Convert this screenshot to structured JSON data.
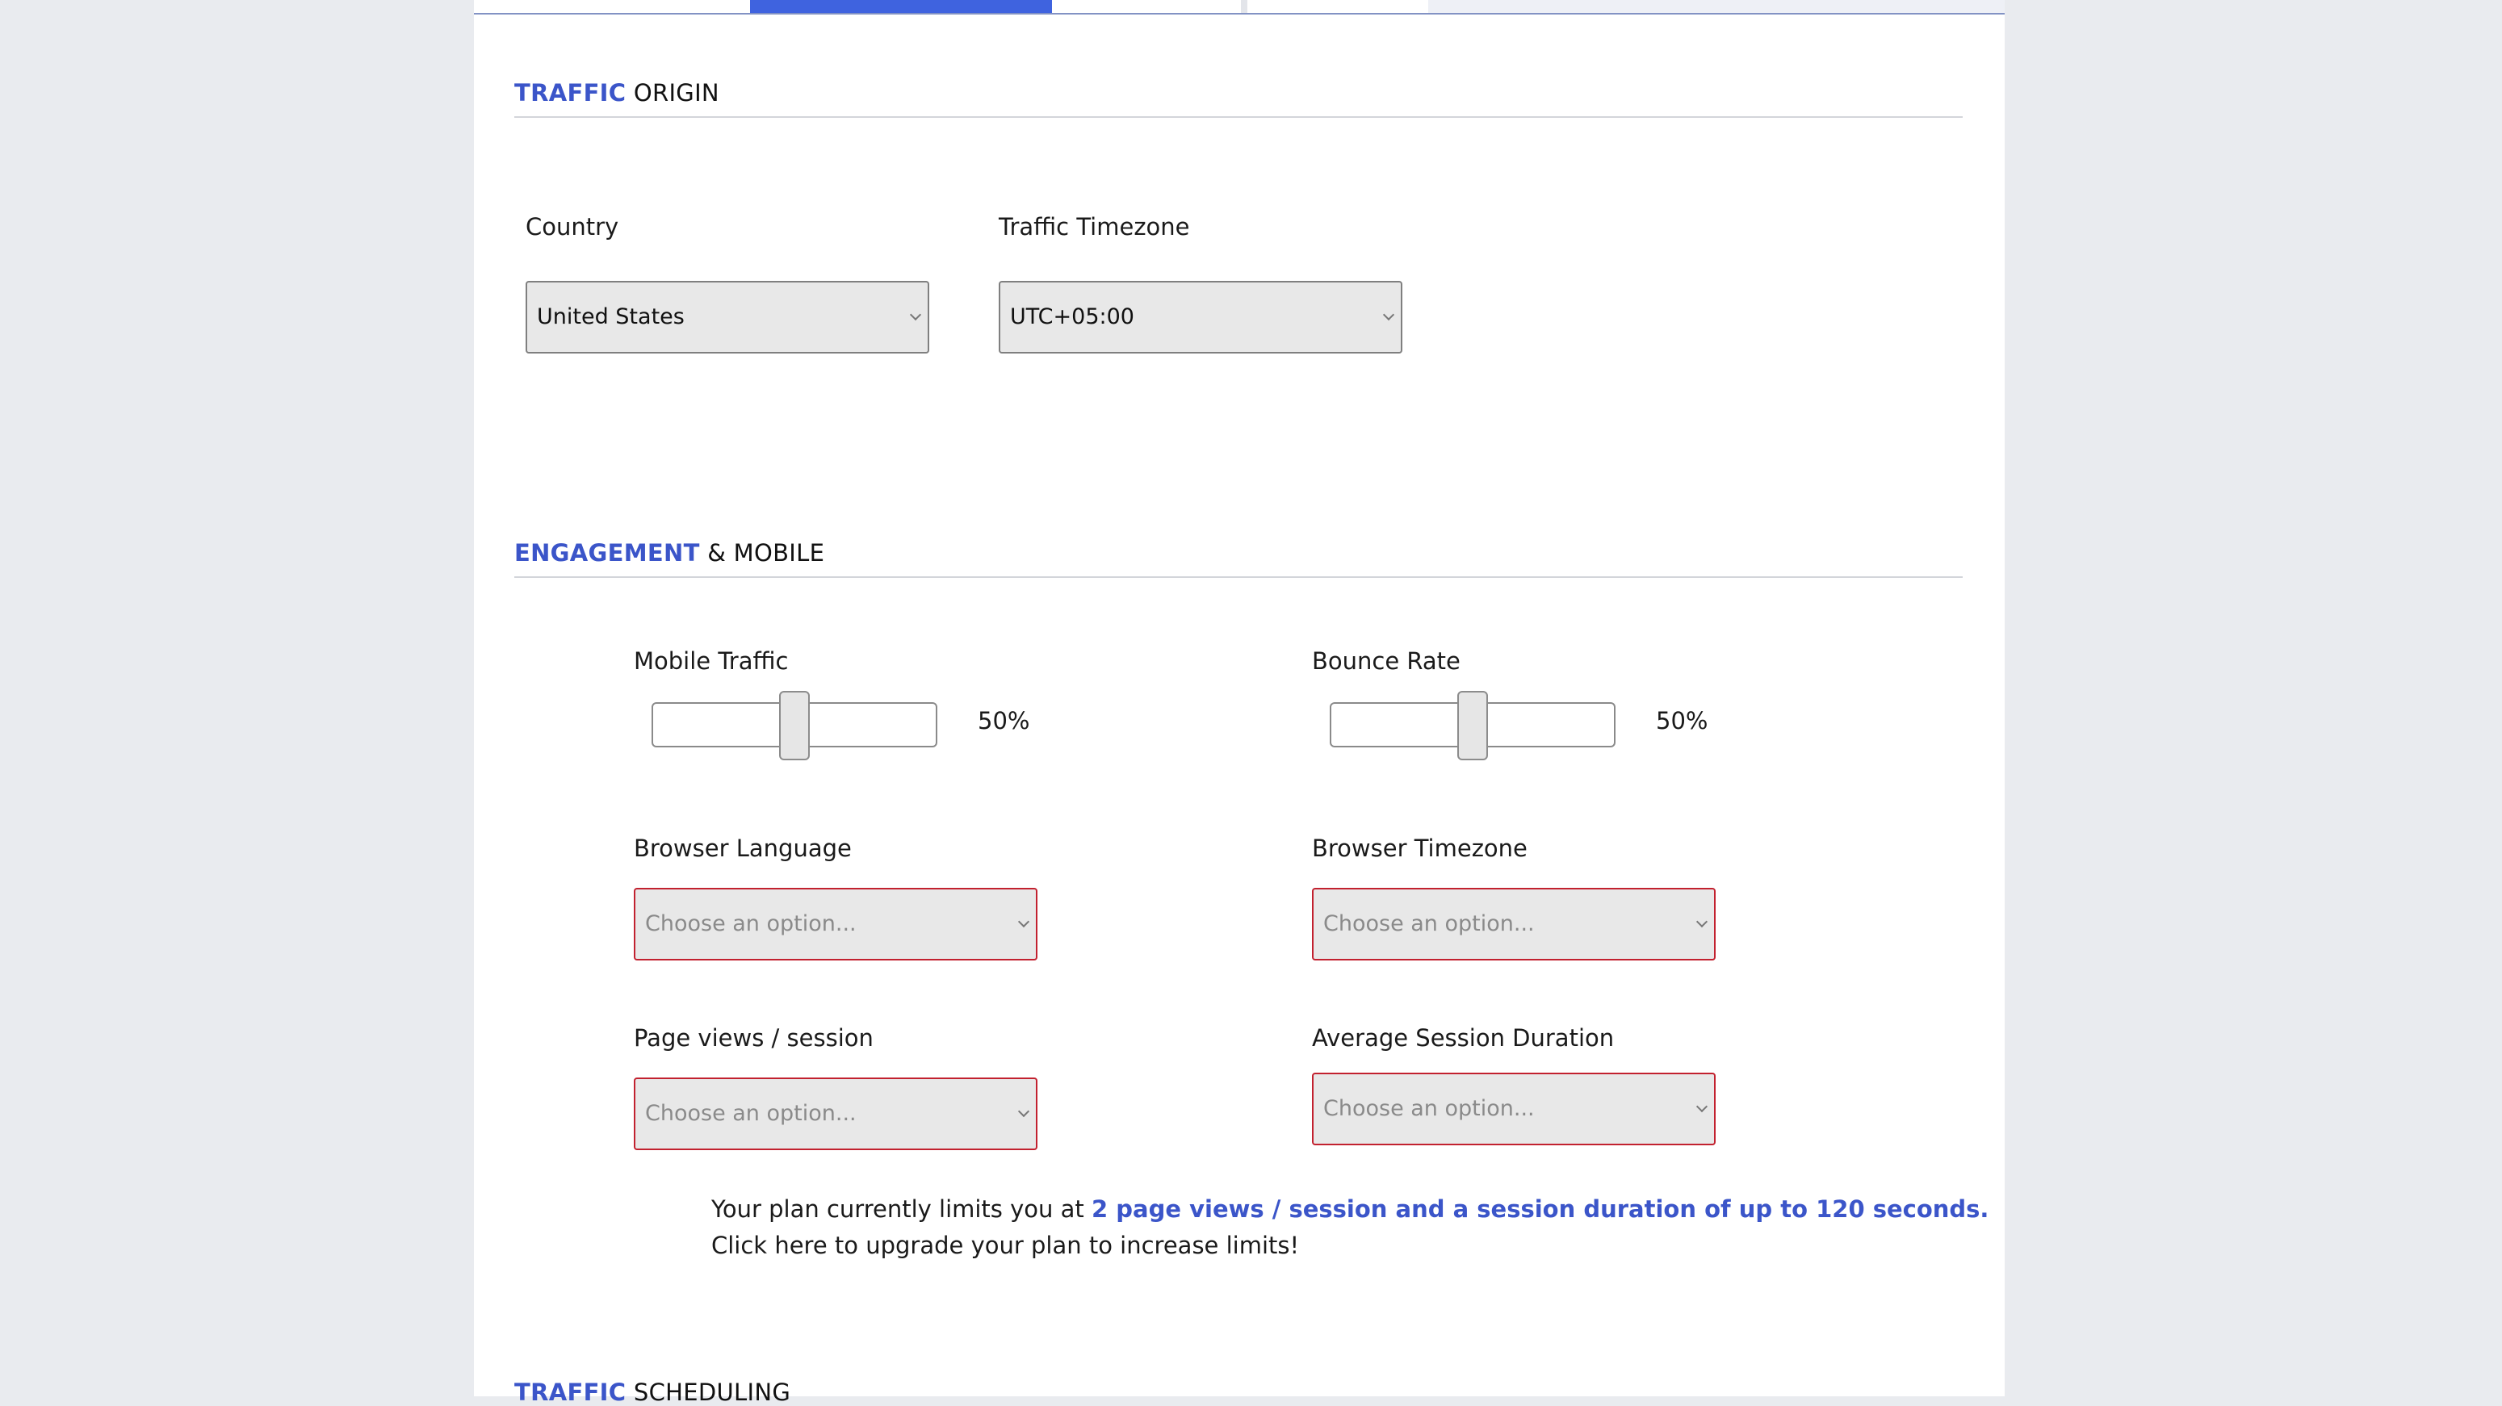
{
  "sections": {
    "origin": {
      "accent": "TRAFFIC",
      "rest": " ORIGIN"
    },
    "engagement": {
      "accent": "ENGAGEMENT",
      "rest": " & MOBILE"
    },
    "scheduling": {
      "accent": "TRAFFIC",
      "rest": " SCHEDULING"
    }
  },
  "origin": {
    "country_label": "Country",
    "country_value": "United States",
    "timezone_label": "Traffic Timezone",
    "timezone_value": "UTC+05:00"
  },
  "engagement": {
    "mobile_label": "Mobile Traffic",
    "mobile_value_text": "50%",
    "mobile_value": 50,
    "bounce_label": "Bounce Rate",
    "bounce_value_text": "50%",
    "bounce_value": 50,
    "browser_language_label": "Browser Language",
    "browser_language_value": "Choose an option...",
    "browser_timezone_label": "Browser Timezone",
    "browser_timezone_value": "Choose an option...",
    "pageviews_label": "Page views / session",
    "pageviews_value": "Choose an option...",
    "duration_label": "Average Session Duration",
    "duration_value": "Choose an option..."
  },
  "notice": {
    "prefix": "Your plan currently limits you at ",
    "highlight": "2 page views / session and a session duration of up to 120 seconds.",
    "line2": "Click here to upgrade your plan to increase limits!"
  },
  "colors": {
    "accent": "#3b55c9",
    "active_tab": "#3f63df",
    "invalid_border": "#c2212f"
  }
}
